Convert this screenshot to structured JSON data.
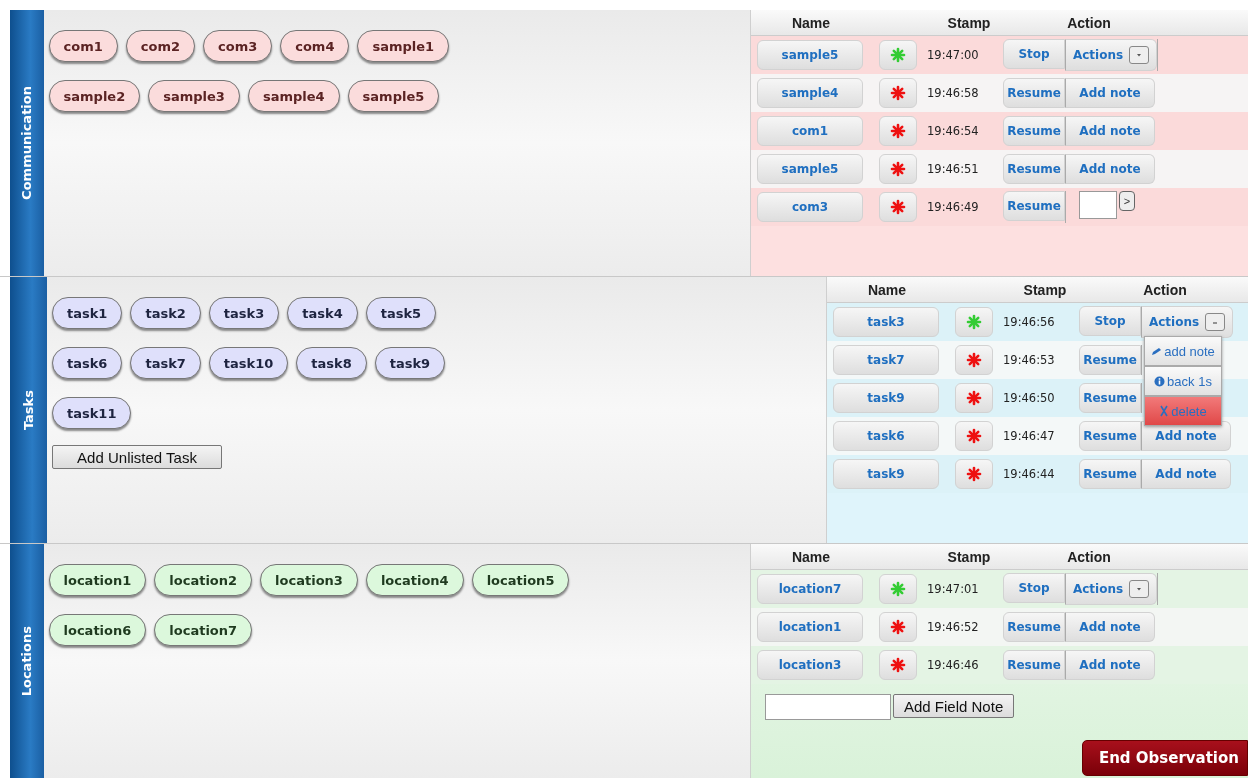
{
  "sections": [
    {
      "title": "Communication",
      "chip_rows": [
        [
          "com1",
          "com2",
          "com3",
          "com4",
          "sample1"
        ],
        [
          "sample2",
          "sample3",
          "sample4",
          "sample5"
        ]
      ],
      "log": {
        "columns": [
          "Name",
          "Stamp",
          "Action"
        ],
        "rows": [
          {
            "name": "sample5",
            "running": true,
            "stamp": "19:47:00",
            "primary": "Stop",
            "secondary": {
              "kind": "dropdown",
              "label": "Actions",
              "expanded": false
            }
          },
          {
            "name": "sample4",
            "running": false,
            "stamp": "19:46:58",
            "primary": "Resume",
            "secondary": {
              "kind": "button",
              "label": "Add note"
            }
          },
          {
            "name": "com1",
            "running": false,
            "stamp": "19:46:54",
            "primary": "Resume",
            "secondary": {
              "kind": "button",
              "label": "Add note"
            }
          },
          {
            "name": "sample5",
            "running": false,
            "stamp": "19:46:51",
            "primary": "Resume",
            "secondary": {
              "kind": "button",
              "label": "Add note"
            }
          },
          {
            "name": "com3",
            "running": false,
            "stamp": "19:46:49",
            "primary": "Resume",
            "secondary": {
              "kind": "note-input",
              "submit": ">"
            }
          }
        ]
      }
    },
    {
      "title": "Tasks",
      "chip_rows": [
        [
          "task1",
          "task2",
          "task3",
          "task4",
          "task5"
        ],
        [
          "task6",
          "task7",
          "task10",
          "task8",
          "task9"
        ],
        [
          "task11"
        ]
      ],
      "add_button": "Add Unlisted Task",
      "log": {
        "columns": [
          "Name",
          "Stamp",
          "Action"
        ],
        "rows": [
          {
            "name": "task3",
            "running": true,
            "stamp": "19:46:56",
            "primary": "Stop",
            "secondary": {
              "kind": "dropdown",
              "label": "Actions",
              "expanded": true,
              "menu": [
                {
                  "kind": "edit",
                  "label": "add note"
                },
                {
                  "kind": "info",
                  "label": "back 1s"
                },
                {
                  "kind": "delete",
                  "label": "delete"
                }
              ]
            }
          },
          {
            "name": "task7",
            "running": false,
            "stamp": "19:46:53",
            "primary": "Resume",
            "secondary": {
              "kind": "hidden"
            }
          },
          {
            "name": "task9",
            "running": false,
            "stamp": "19:46:50",
            "primary": "Resume",
            "secondary": {
              "kind": "hidden"
            }
          },
          {
            "name": "task6",
            "running": false,
            "stamp": "19:46:47",
            "primary": "Resume",
            "secondary": {
              "kind": "button",
              "label": "Add note"
            }
          },
          {
            "name": "task9",
            "running": false,
            "stamp": "19:46:44",
            "primary": "Resume",
            "secondary": {
              "kind": "button",
              "label": "Add note"
            }
          }
        ]
      }
    },
    {
      "title": "Locations",
      "chip_rows": [
        [
          "location1",
          "location2",
          "location3",
          "location4",
          "location5"
        ],
        [
          "location6",
          "location7"
        ]
      ],
      "log": {
        "columns": [
          "Name",
          "Stamp",
          "Action"
        ],
        "rows": [
          {
            "name": "location7",
            "running": true,
            "stamp": "19:47:01",
            "primary": "Stop",
            "secondary": {
              "kind": "dropdown",
              "label": "Actions",
              "expanded": false
            }
          },
          {
            "name": "location1",
            "running": false,
            "stamp": "19:46:52",
            "primary": "Resume",
            "secondary": {
              "kind": "button",
              "label": "Add note"
            }
          },
          {
            "name": "location3",
            "running": false,
            "stamp": "19:46:46",
            "primary": "Resume",
            "secondary": {
              "kind": "button",
              "label": "Add note"
            }
          }
        ],
        "field_note": {
          "button": "Add Field Note"
        },
        "end_button": "End Observation"
      }
    }
  ]
}
